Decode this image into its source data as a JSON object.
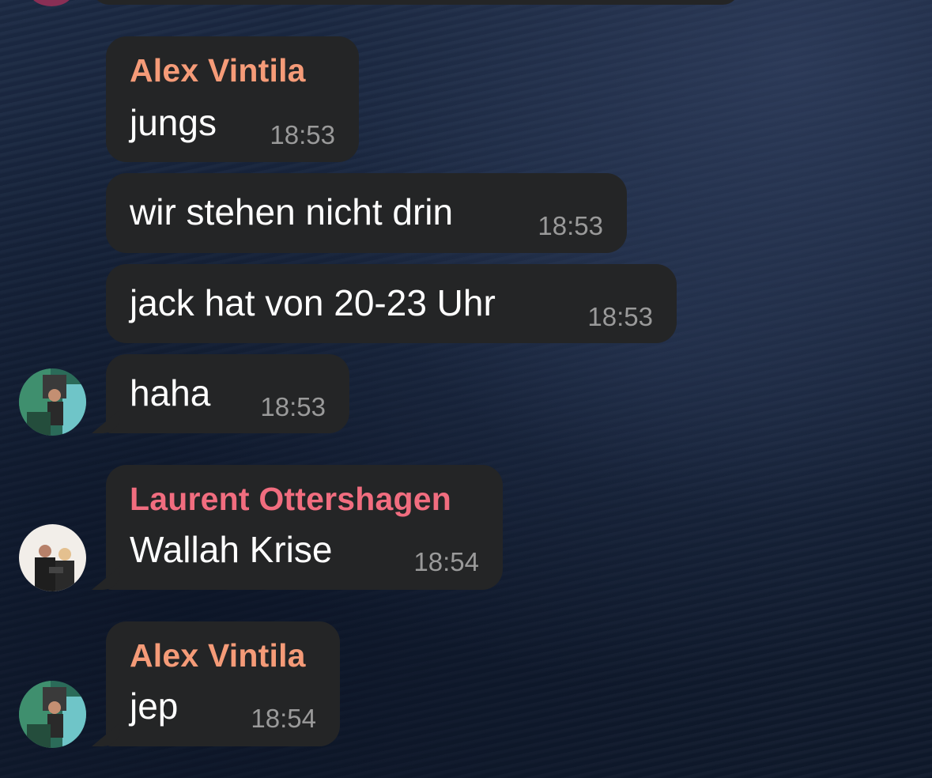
{
  "colors": {
    "bubble": "#242526",
    "text": "#ffffff",
    "time": "#9a9a9a",
    "sender_alex": "#f59b78",
    "sender_laurent": "#f16d7f"
  },
  "messages": [
    {
      "sender": "Alex Vintila",
      "text": "jungs",
      "time": "18:53"
    },
    {
      "sender": "",
      "text": "wir stehen nicht drin",
      "time": "18:53"
    },
    {
      "sender": "",
      "text": "jack hat von 20-23 Uhr",
      "time": "18:53"
    },
    {
      "sender": "",
      "text": "haha",
      "time": "18:53",
      "avatar": "alex-avatar"
    },
    {
      "sender": "Laurent Ottershagen",
      "text": "Wallah Krise",
      "time": "18:54",
      "avatar": "laurent-avatar"
    },
    {
      "sender": "Alex Vintila",
      "text": "jep",
      "time": "18:54",
      "avatar": "alex-avatar"
    }
  ]
}
